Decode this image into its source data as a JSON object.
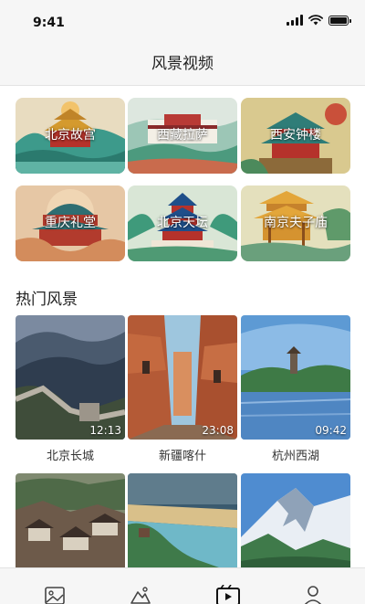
{
  "status_bar": {
    "time": "9:41"
  },
  "header": {
    "title": "风景视频"
  },
  "categories": [
    {
      "label": "北京故宫",
      "icon": "palace-illustration"
    },
    {
      "label": "西藏拉萨",
      "icon": "potala-illustration"
    },
    {
      "label": "西安钟楼",
      "icon": "bell-tower-illustration"
    },
    {
      "label": "重庆礼堂",
      "icon": "great-hall-illustration"
    },
    {
      "label": "北京天坛",
      "icon": "temple-of-heaven-illustration"
    },
    {
      "label": "南京夫子庙",
      "icon": "confucius-temple-illustration"
    }
  ],
  "hot_section": {
    "title": "热门风景"
  },
  "videos": [
    {
      "name": "北京长城",
      "duration": "12:13"
    },
    {
      "name": "新疆喀什",
      "duration": "23:08"
    },
    {
      "name": "杭州西湖",
      "duration": "09:42"
    }
  ],
  "more_videos": [
    {
      "thumbnail": "village-rooftops"
    },
    {
      "thumbnail": "beach-coast"
    },
    {
      "thumbnail": "snow-mountain"
    }
  ],
  "tabbar": {
    "tabs": [
      {
        "icon": "image-icon",
        "active": false
      },
      {
        "icon": "mountain-icon",
        "active": false
      },
      {
        "icon": "video-icon",
        "active": true
      },
      {
        "icon": "user-icon",
        "active": false
      }
    ]
  },
  "colors": {
    "background": "#ffffff",
    "bar": "#f6f6f6",
    "text": "#222222"
  }
}
